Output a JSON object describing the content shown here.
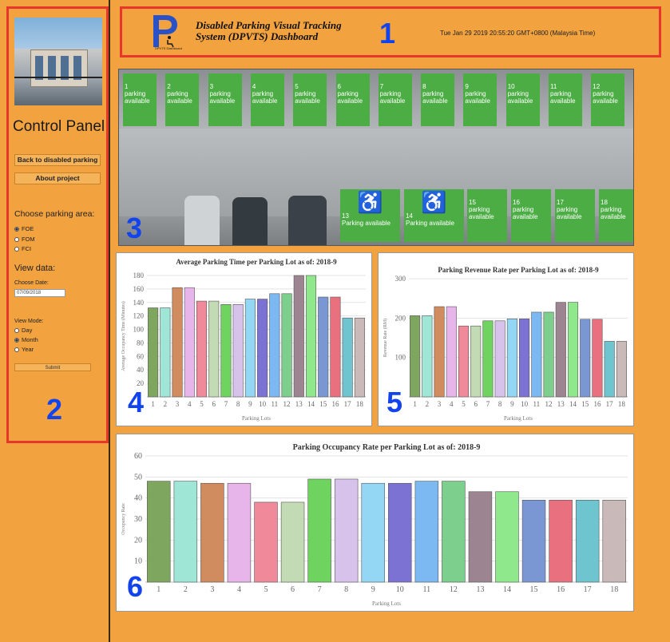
{
  "labels": {
    "n1": "1",
    "n2": "2",
    "n3": "3",
    "n4": "4",
    "n5": "5",
    "n6": "6"
  },
  "sidebar": {
    "title": "Control Panel",
    "btn_back": "Back to disabled parking",
    "btn_about": "About project",
    "choose_area": "Choose parking area:",
    "areas": [
      {
        "label": "FOE",
        "selected": true
      },
      {
        "label": "FOM",
        "selected": false
      },
      {
        "label": "FCI",
        "selected": false
      }
    ],
    "view_data": "View data:",
    "choose_date": "Choose Date:",
    "date_value": "07/09/2018",
    "view_mode": "View Mode:",
    "modes": [
      {
        "label": "Day",
        "selected": false
      },
      {
        "label": "Month",
        "selected": true
      },
      {
        "label": "Year",
        "selected": false
      }
    ],
    "submit": "Submit"
  },
  "header": {
    "logo_text": "DPVTS Dashboard",
    "title": "Disabled Parking Visual Tracking System (DPVTS) Dashboard",
    "datetime": "Tue Jan 29 2019 20:55:20 GMT+0800 (Malaysia Time)"
  },
  "lots_top": [
    {
      "num": "1",
      "status": "parking available"
    },
    {
      "num": "2",
      "status": "parking available"
    },
    {
      "num": "3",
      "status": "parking available"
    },
    {
      "num": "4",
      "status": "parking available"
    },
    {
      "num": "5",
      "status": "parking available"
    },
    {
      "num": "6",
      "status": "parking available"
    },
    {
      "num": "7",
      "status": "parking available"
    },
    {
      "num": "8",
      "status": "parking available"
    },
    {
      "num": "9",
      "status": "parking available"
    },
    {
      "num": "10",
      "status": "parking available"
    },
    {
      "num": "11",
      "status": "parking available"
    },
    {
      "num": "12",
      "status": "parking available"
    }
  ],
  "lots_bottom": [
    {
      "num": "13",
      "status": "Parking available",
      "disabled": true
    },
    {
      "num": "14",
      "status": "Parking available",
      "disabled": true
    },
    {
      "num": "15",
      "status": "parking available",
      "disabled": false
    },
    {
      "num": "16",
      "status": "parking available",
      "disabled": false
    },
    {
      "num": "17",
      "status": "parking available",
      "disabled": false
    },
    {
      "num": "18",
      "status": "parking available",
      "disabled": false
    }
  ],
  "bar_colors": [
    "#7fa65f",
    "#9fe6d6",
    "#d08b5e",
    "#e8b5ea",
    "#f08a9a",
    "#c3dbb4",
    "#6fd45f",
    "#d7c2eb",
    "#94d7f4",
    "#7b72d4",
    "#7cb8f2",
    "#7ccf8c",
    "#9c8590",
    "#8fe88c",
    "#7a97d4",
    "#e8707f",
    "#6ec4cf",
    "#c9b9b9"
  ],
  "chart_data": [
    {
      "type": "bar",
      "title": "Average Parking Time per Parking Lot as of: 2018-9",
      "xlabel": "Parking Lots",
      "ylabel": "Average Occupancy Time (Minutes)",
      "categories": [
        "1",
        "2",
        "3",
        "4",
        "5",
        "6",
        "7",
        "8",
        "9",
        "10",
        "11",
        "12",
        "13",
        "14",
        "15",
        "16",
        "17",
        "18"
      ],
      "values": [
        132,
        132,
        162,
        162,
        142,
        142,
        137,
        137,
        145,
        145,
        153,
        153,
        180,
        180,
        148,
        148,
        117,
        117
      ],
      "ylim": [
        0,
        180
      ],
      "yticks": [
        20,
        40,
        60,
        80,
        100,
        120,
        140,
        160,
        180
      ],
      "grid": true
    },
    {
      "type": "bar",
      "title": "Parking Revenue Rate per Parking Lot as of: 2018-9",
      "xlabel": "Parking Lots",
      "ylabel": "Revenue Rate (RM)",
      "categories": [
        "1",
        "2",
        "3",
        "4",
        "5",
        "6",
        "7",
        "8",
        "9",
        "10",
        "11",
        "12",
        "13",
        "14",
        "15",
        "16",
        "17",
        "18"
      ],
      "values": [
        206,
        206,
        229,
        229,
        180,
        180,
        193,
        193,
        198,
        198,
        215,
        215,
        240,
        240,
        197,
        197,
        141,
        141
      ],
      "ylim": [
        0,
        300
      ],
      "yticks": [
        100,
        200,
        300
      ],
      "grid": true
    },
    {
      "type": "bar",
      "title": "Parking Occupancy Rate per Parking Lot as of: 2018-9",
      "xlabel": "Parking Lots",
      "ylabel": "Occupancy Rate",
      "categories": [
        "1",
        "2",
        "3",
        "4",
        "5",
        "6",
        "7",
        "8",
        "9",
        "10",
        "11",
        "12",
        "13",
        "14",
        "15",
        "16",
        "17",
        "18"
      ],
      "values": [
        48,
        48,
        47,
        47,
        38,
        38,
        49,
        49,
        47,
        47,
        48,
        48,
        43,
        43,
        39,
        39,
        39,
        39
      ],
      "ylim": [
        0,
        60
      ],
      "yticks": [
        10,
        20,
        30,
        40,
        50,
        60
      ],
      "grid": true
    }
  ]
}
